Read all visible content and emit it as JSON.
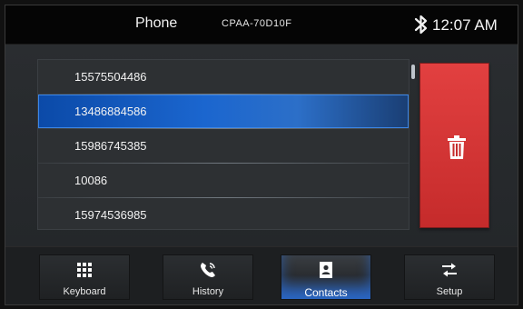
{
  "header": {
    "title": "Phone",
    "device_name": "CPAA-70D10F",
    "time": "12:07 AM"
  },
  "contacts": [
    "15575504486",
    "13486884586",
    "15986745385",
    "10086",
    "15974536985"
  ],
  "tabs": [
    {
      "label": "Keyboard",
      "icon": "keypad-icon"
    },
    {
      "label": "History",
      "icon": "phone-history-icon"
    },
    {
      "label": "Contacts",
      "icon": "contacts-icon"
    },
    {
      "label": "Setup",
      "icon": "transfer-arrows-icon"
    }
  ],
  "colors": {
    "delete": "#d33636",
    "selected": "#1b66cf"
  }
}
